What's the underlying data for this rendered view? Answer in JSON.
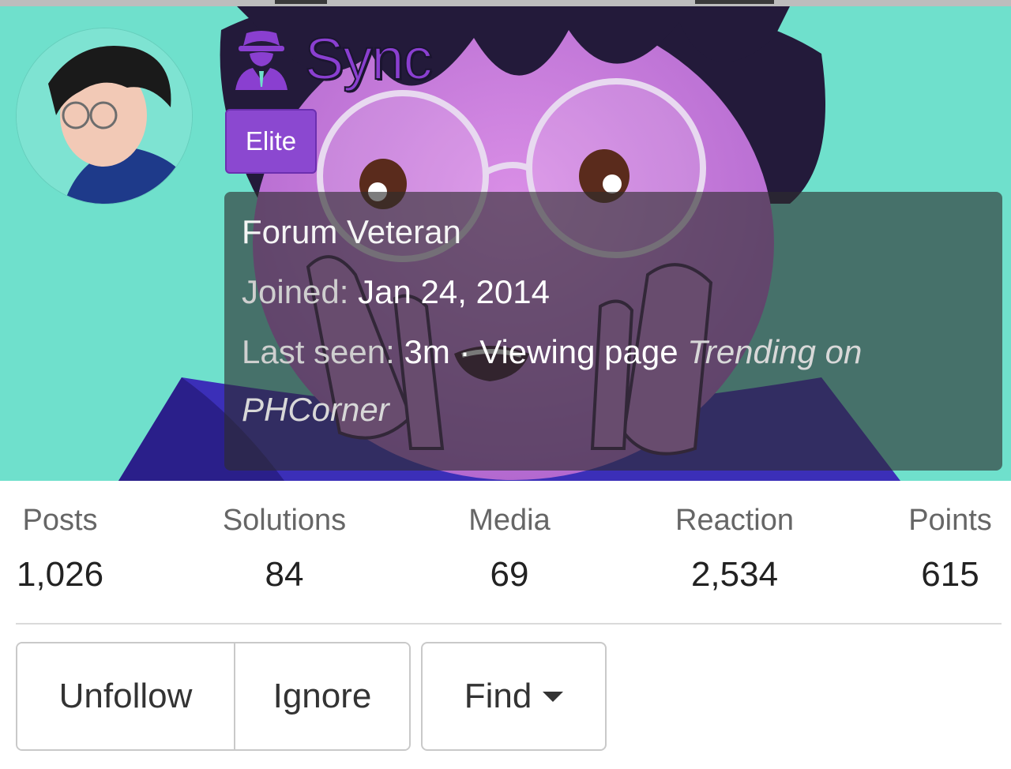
{
  "profile": {
    "username": "Sync",
    "user_icon": "spy-icon",
    "badge": "Elite",
    "title": "Forum Veteran",
    "joined_label": "Joined:",
    "joined_value": "Jan 24, 2014",
    "last_seen_label": "Last seen:",
    "last_seen_value": "3m",
    "separator": "·",
    "activity_label": "Viewing page",
    "activity_page_line1": "Trending on",
    "activity_page_line2": "PHCorner"
  },
  "stats": [
    {
      "label": "Posts",
      "value": "1,026"
    },
    {
      "label": "Solutions",
      "value": "84"
    },
    {
      "label": "Media",
      "value": "69"
    },
    {
      "label": "Reaction",
      "value": "2,534"
    },
    {
      "label": "Points",
      "value": "615"
    }
  ],
  "actions": {
    "unfollow": "Unfollow",
    "ignore": "Ignore",
    "find": "Find"
  },
  "colors": {
    "accent": "#8b48d0",
    "banner_bg": "#6fe0cc"
  }
}
